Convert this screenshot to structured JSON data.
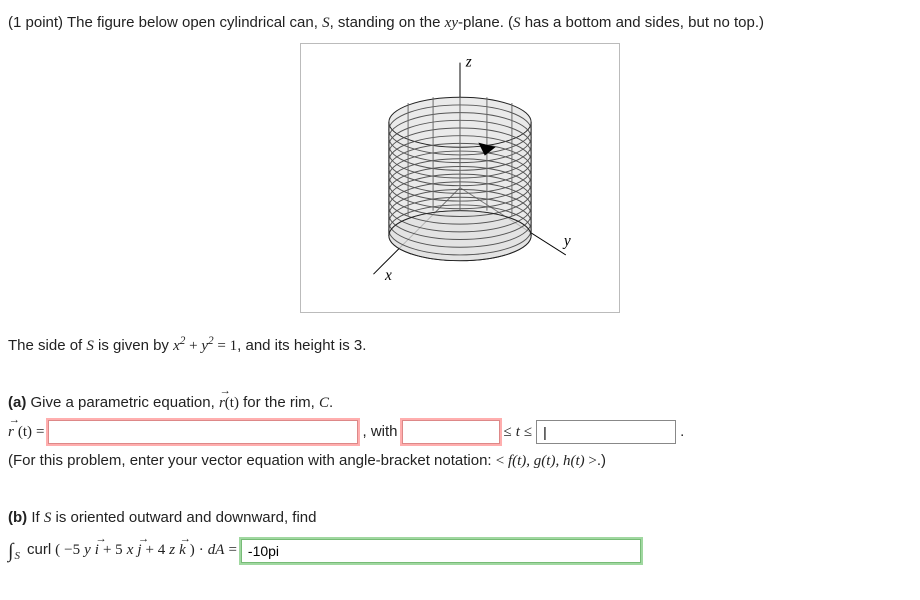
{
  "points": "(1 point)",
  "intro_pre": "The figure below open cylindrical can, ",
  "intro_S": "S",
  "intro_mid": ", standing on the ",
  "intro_xy": "xy",
  "intro_post1": "-plane. (",
  "intro_post2": " has a bottom and sides, but no top.)",
  "figure": {
    "axis_z": "z",
    "axis_x": "x",
    "axis_y": "y"
  },
  "side_pre": "The side of ",
  "side_S": "S",
  "side_mid": " is given by ",
  "side_eq_x": "x",
  "side_eq_sq1": "2",
  "side_eq_plus": " + ",
  "side_eq_y": "y",
  "side_eq_sq2": "2",
  "side_eq_eq": " = 1",
  "side_post": ", and its height is 3.",
  "a_label": "(a)",
  "a_text_pre": " Give a parametric equation, ",
  "a_r": "r",
  "a_rt_arg": "(t)",
  "a_text_mid": " for the rim, ",
  "a_C": "C",
  "a_text_post": ".",
  "a_rt_eq": " = ",
  "a_with": " , with ",
  "a_le1": " ≤ ",
  "a_t": "t",
  "a_le2": " ≤ ",
  "a_period": " .",
  "a_note_pre": "(For this problem, enter your vector equation with angle-bracket notation: ",
  "a_note_lt": "< ",
  "a_note_f": "f(t), g(t), h(t)",
  "a_note_gt": " >",
  "a_note_post": ".)",
  "b_label": "(b)",
  "b_text_pre": " If ",
  "b_S": "S",
  "b_text_post": " is oriented outward and downward, find",
  "b_int": "∫",
  "b_sub": "S",
  "b_curl": " curl ",
  "b_vec_open": "(",
  "b_term1_coef": "−5",
  "b_term1_var": "y",
  "b_i": "i",
  "b_plus1": " + 5",
  "b_term2_var": "x",
  "b_j": "j",
  "b_plus2": " + 4",
  "b_term3_var": "z",
  "b_k": "k",
  "b_vec_close": ")",
  "b_dot": " · ",
  "b_dA": "dA",
  "b_eq": " = ",
  "inputs": {
    "rt_value": "",
    "t_low_value": "",
    "t_high_value": "|",
    "b_value": "-10pi"
  }
}
